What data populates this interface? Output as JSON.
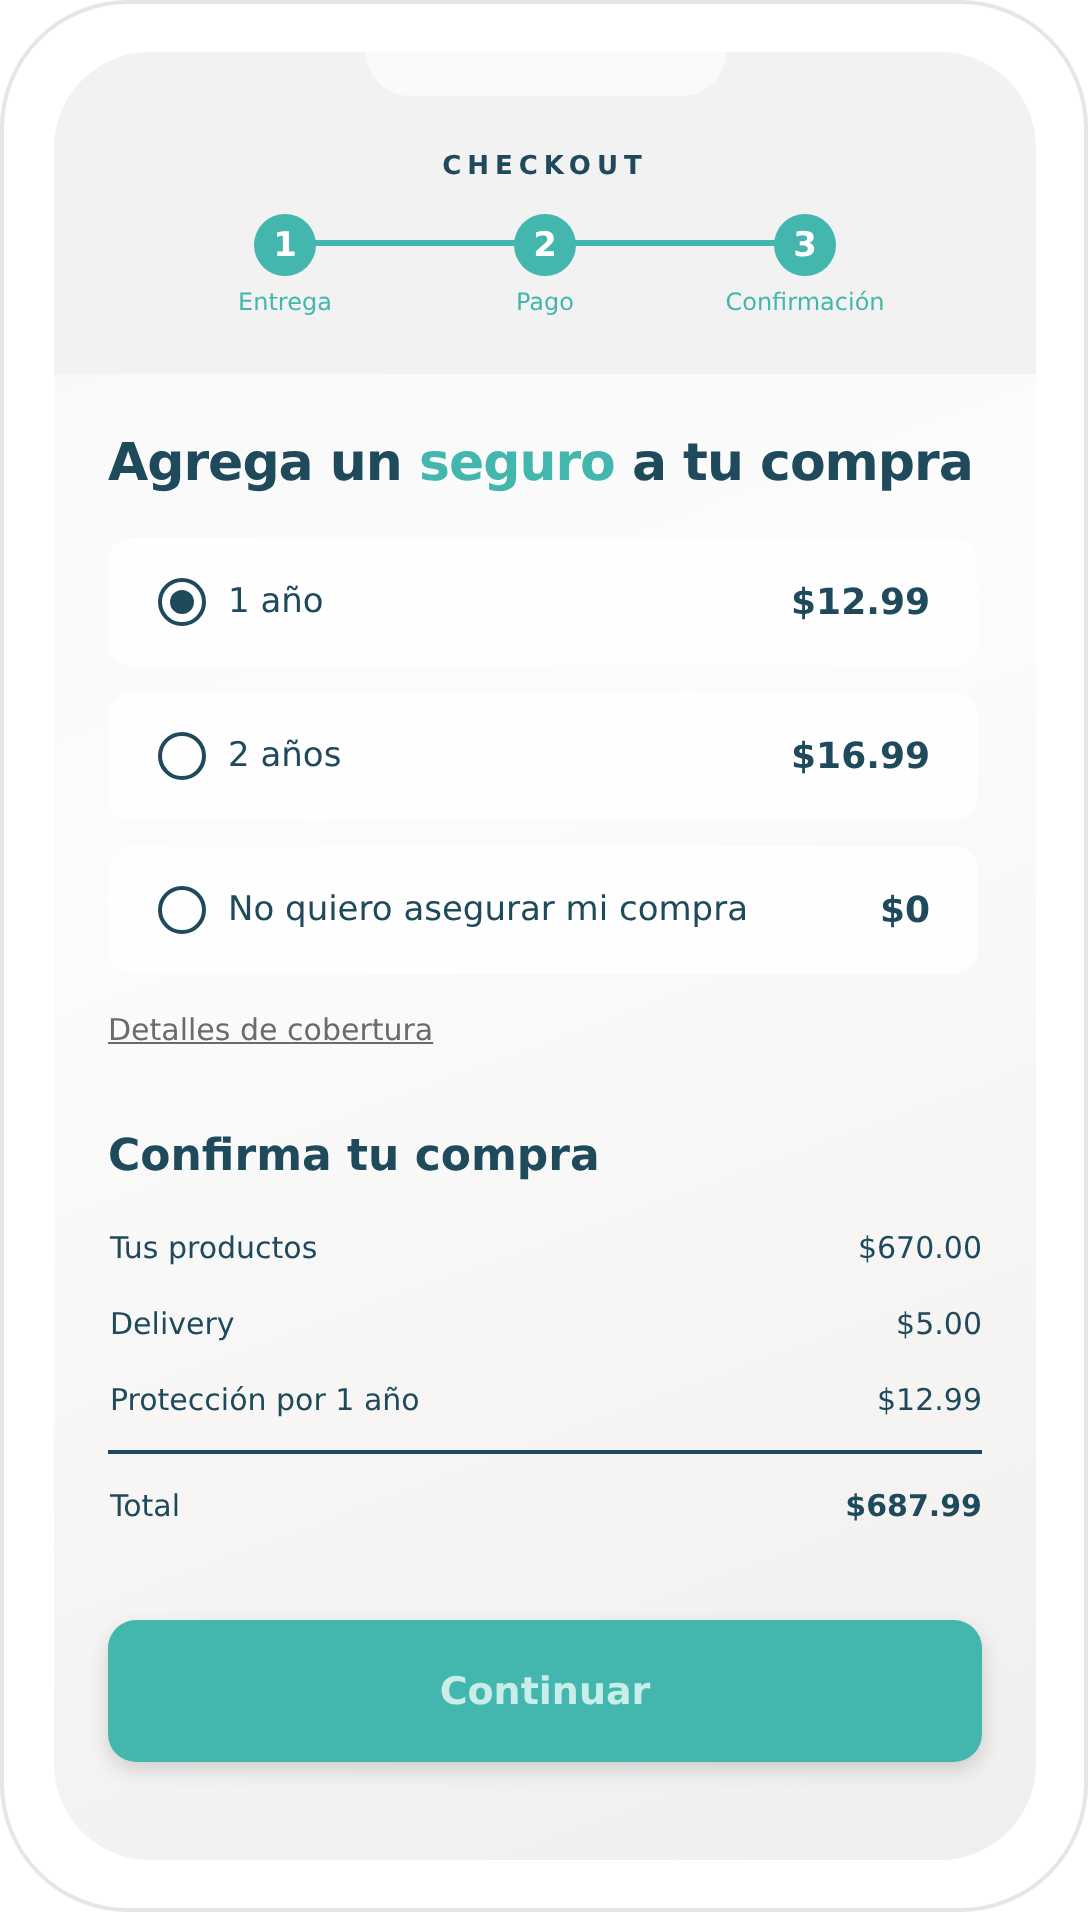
{
  "header": {
    "title": "CHECKOUT",
    "steps": [
      {
        "number": "1",
        "label": "Entrega"
      },
      {
        "number": "2",
        "label": "Pago"
      },
      {
        "number": "3",
        "label": "Confirmación"
      }
    ]
  },
  "insurance": {
    "heading": [
      {
        "text": "Agrega un ",
        "accent": false
      },
      {
        "text": "seguro",
        "accent": true
      },
      {
        "text": " a tu compra",
        "accent": false
      }
    ],
    "options": [
      {
        "label": "1 año",
        "price": "$12.99",
        "selected": true
      },
      {
        "label": "2 años",
        "price": "$16.99",
        "selected": false
      },
      {
        "label": "No quiero asegurar mi compra",
        "price": "$0",
        "selected": false
      }
    ],
    "link": "Detalles de cobertura"
  },
  "summary": {
    "heading": "Confirma tu compra",
    "rows": [
      {
        "kind": "item",
        "label": "Tus productos",
        "value": "$670.00"
      },
      {
        "kind": "item",
        "label": "Delivery",
        "value": "$5.00"
      },
      {
        "kind": "item",
        "label": "Protección por 1 año",
        "value": "$12.99"
      },
      {
        "kind": "total",
        "label": "Total",
        "value": "$687.99"
      }
    ]
  },
  "button": {
    "label": "Continuar"
  }
}
